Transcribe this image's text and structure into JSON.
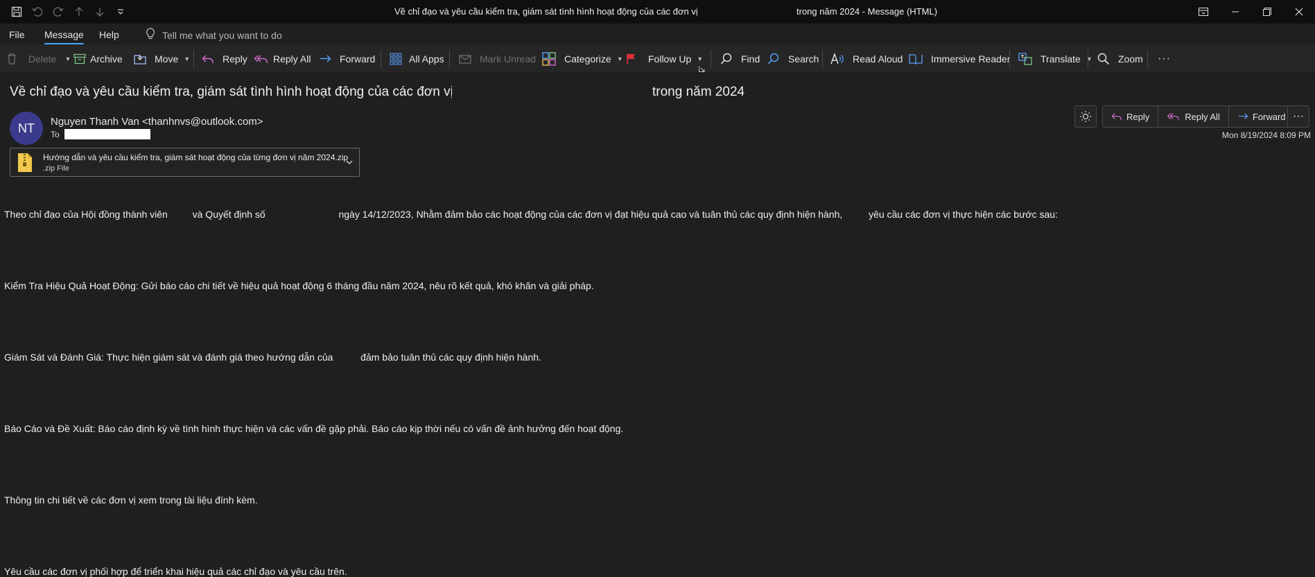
{
  "window": {
    "title_part1": "Về chỉ đạo và yêu cầu kiểm tra, giám sát tình hình hoạt động của các đơn vị",
    "title_part2": "trong năm 2024  - Message (HTML)"
  },
  "quick_access": [
    "save-icon",
    "undo-icon",
    "redo-icon",
    "up-icon",
    "down-icon",
    "customize-icon"
  ],
  "menu": {
    "file": "File",
    "message": "Message",
    "help": "Help",
    "tell_me": "Tell me what you want to do"
  },
  "ribbon": {
    "delete": "Delete",
    "archive": "Archive",
    "move": "Move",
    "reply": "Reply",
    "reply_all": "Reply All",
    "forward": "Forward",
    "all_apps": "All Apps",
    "mark_unread": "Mark Unread",
    "categorize": "Categorize",
    "follow_up": "Follow Up",
    "find": "Find",
    "search": "Search",
    "read_aloud": "Read Aloud",
    "immersive_reader": "Immersive Reader",
    "translate": "Translate",
    "zoom": "Zoom",
    "more": "···"
  },
  "message": {
    "subject_part1": "Về chỉ đạo và yêu cầu kiểm tra, giám sát tình hình hoạt động của các đơn vị",
    "subject_part2": "trong năm 2024",
    "avatar_initials": "NT",
    "sender": "Nguyen Thanh Van <thanhnvs@outlook.com>",
    "to_label": "To",
    "datetime": "Mon 8/19/2024 8:09 PM",
    "reply": "Reply",
    "reply_all": "Reply All",
    "forward": "Forward",
    "attachment": {
      "name": "Hướng dẫn và yêu cầu kiểm tra, giám sát hoạt động của từng đơn vị năm 2024.zip",
      "type": ".zip File"
    }
  },
  "body": {
    "line1_a": "Theo chỉ đạo của Hội đồng thành viên",
    "line1_b": "và Quyết định số",
    "line1_c": "ngày 14/12/2023, Nhằm đảm bảo các hoạt động của các đơn vị đạt hiệu quả cao và tuân thủ các quy định hiện hành,",
    "line1_d": "yêu cầu các đơn vị thực hiện các bước sau:",
    "line2": "Kiểm Tra Hiệu Quả Hoạt Động: Gửi báo cáo chi tiết về hiệu quả hoạt động 6 tháng đầu năm 2024, nêu rõ kết quả, khó khăn và giải pháp.",
    "line3_a": "Giám Sát và Đánh Giá: Thực hiện giám sát và đánh giá theo hướng dẫn của",
    "line3_b": "đảm bảo tuân thủ các quy định hiện hành.",
    "line4": "Báo Cáo và Đề Xuất: Báo cáo định kỳ về tình hình thực hiện và các vấn đề gặp phải. Báo cáo kịp thời nếu có vấn đề ảnh hưởng đến hoạt động.",
    "line5": "Thông tin chi tiết về các đơn vị xem trong tài liệu đính kèm.",
    "line6": "Yêu cầu các đơn vị phối hợp để triển khai hiệu quả các chỉ đạo và yêu cầu trên."
  },
  "colors": {
    "background": "#1f1f1f",
    "titlebar": "#0f0f0f",
    "ribbon": "#262626",
    "accent": "#4aa3ff",
    "avatar": "#3b3a8c",
    "reply_icon": "#d56fd0",
    "follow_up_flag": "#e0303a"
  }
}
